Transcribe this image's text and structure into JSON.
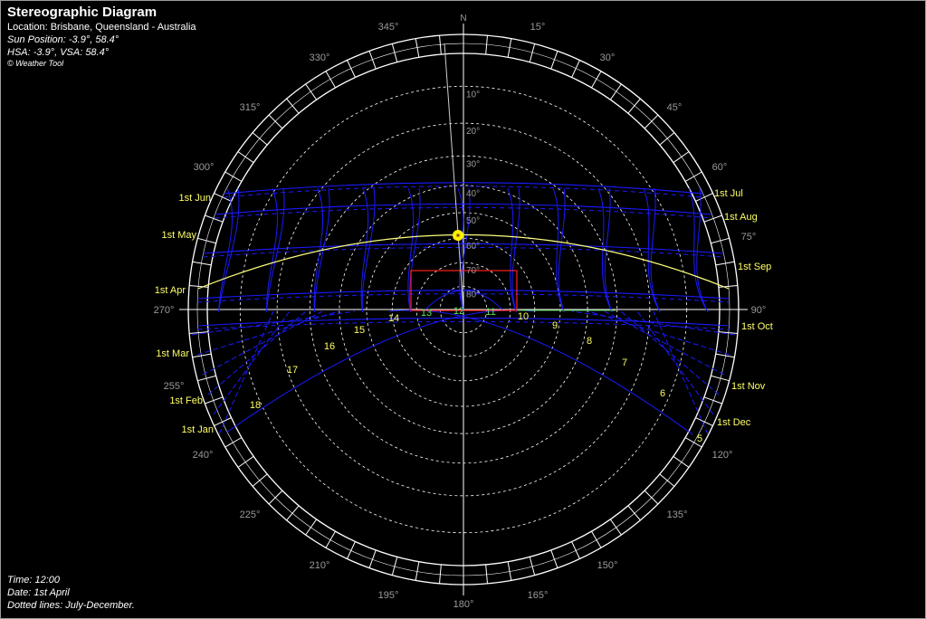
{
  "header": {
    "title": "Stereographic Diagram",
    "location": "Location: Brisbane, Queensland - Australia",
    "sun_position": "Sun Position: -3.9°, 58.4°",
    "hsa_vsa": "HSA: -3.9°, VSA: 58.4°",
    "copyright": "© Weather Tool"
  },
  "footer": {
    "time": "Time: 12:00",
    "date": "Date: 1st April",
    "note": "Dotted lines: July-December."
  },
  "compass": {
    "north": "N",
    "azimuth_labels": [
      "15°",
      "30°",
      "45°",
      "60°",
      "75°",
      "90°",
      "120°",
      "135°",
      "150°",
      "165°",
      "180°",
      "195°",
      "210°",
      "225°",
      "240°",
      "255°",
      "270°",
      "300°",
      "315°",
      "330°",
      "345°"
    ],
    "altitude_labels": [
      "10°",
      "20°",
      "30°",
      "40°",
      "50°",
      "60°",
      "70°",
      "80°"
    ]
  },
  "month_labels": {
    "left": [
      "1st Jun",
      "1st May",
      "1st Apr",
      "1st Mar",
      "1st Feb",
      "1st Jan"
    ],
    "right": [
      "1st Jul",
      "1st Aug",
      "1st Sep",
      "1st Oct",
      "1st Nov",
      "1st Dec"
    ]
  },
  "hour_labels": [
    "5",
    "6",
    "7",
    "8",
    "9",
    "10",
    "11",
    "12",
    "13",
    "14",
    "15",
    "16",
    "17",
    "18"
  ],
  "colors": {
    "background": "#000000",
    "grid": "#ffffff",
    "sun_path": "#1a1aff",
    "current_path": "#ffff80",
    "sun": "#ffee00",
    "shading": "#ff2020",
    "labels": "#ffff66",
    "axis_labels": "#9a9a9a"
  }
}
